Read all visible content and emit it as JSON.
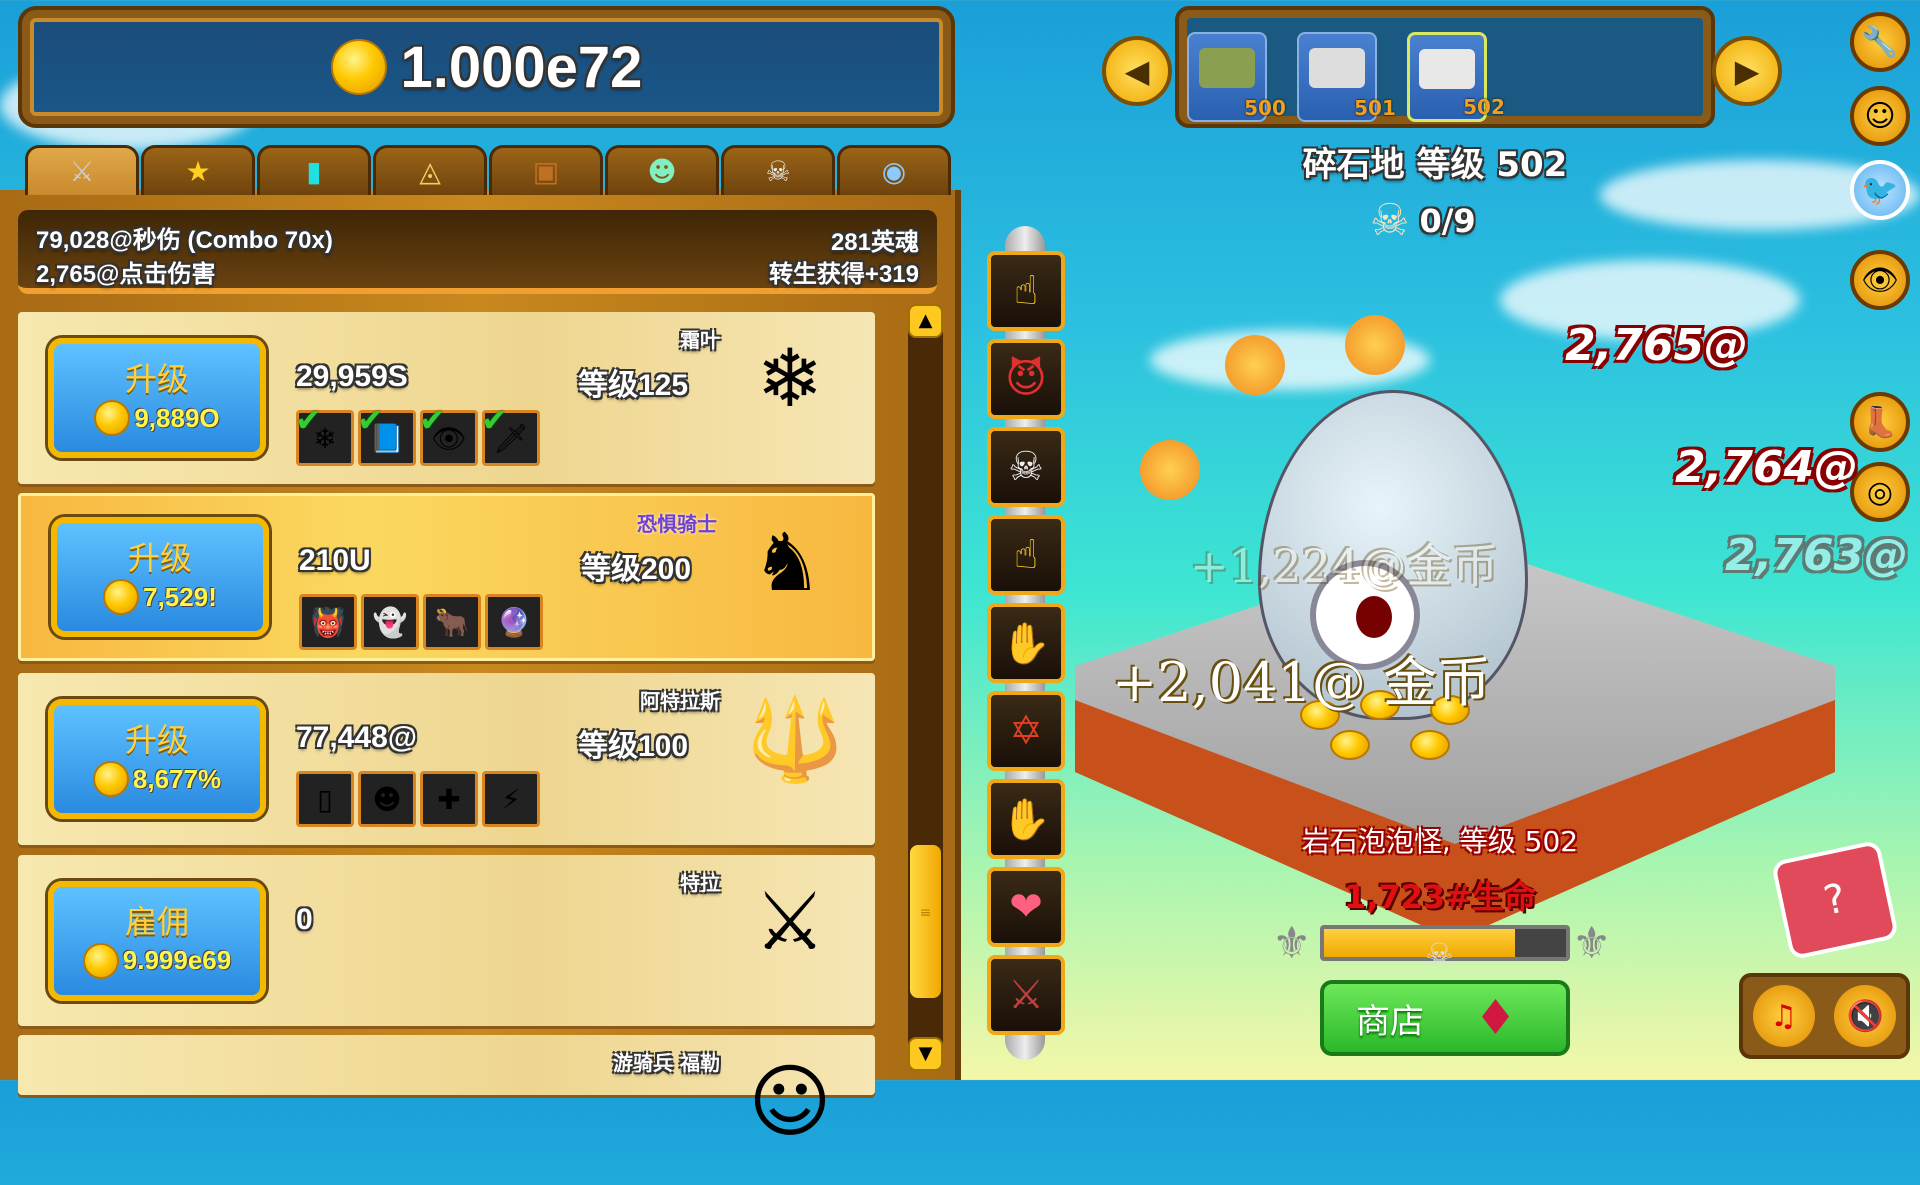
{
  "gold": {
    "value": "1.000e72",
    "icon": "gold-coin-icon"
  },
  "tabs": [
    {
      "name": "heroes",
      "icon": "crossed-swords-icon",
      "glyph": "⚔",
      "active": true
    },
    {
      "name": "achievements",
      "icon": "stars-icon",
      "glyph": "★"
    },
    {
      "name": "stats",
      "icon": "bar-chart-icon",
      "glyph": "▮"
    },
    {
      "name": "ancients",
      "icon": "pyramid-eye-icon",
      "glyph": "◬"
    },
    {
      "name": "relics",
      "icon": "chest-icon",
      "glyph": "▣"
    },
    {
      "name": "clans",
      "icon": "clan-people-icon",
      "glyph": "☻"
    },
    {
      "name": "mercenaries",
      "icon": "skull-icon",
      "glyph": "☠"
    },
    {
      "name": "transcendence",
      "icon": "orb-eye-icon",
      "glyph": "◉"
    }
  ],
  "stats": {
    "dps": "79,028@秒伤 (Combo 70x)",
    "click_damage": "2,765@点击伤害",
    "hero_souls": "281英魂",
    "ascend_gain": "转生获得+319"
  },
  "heroes": [
    {
      "name": "霜叶",
      "dps": "29,959S",
      "level": "等级125",
      "button": "升级",
      "cost": "9,889O",
      "highlighted": false,
      "avatar": "❄",
      "upgrades": [
        {
          "g": "❄",
          "bought": true
        },
        {
          "g": "📘",
          "bought": true
        },
        {
          "g": "👁",
          "bought": true
        },
        {
          "g": "🗡",
          "bought": true
        }
      ]
    },
    {
      "name": "恐惧骑士",
      "dps": "210U",
      "level": "等级200",
      "button": "升级",
      "cost": "7,529!",
      "highlighted": true,
      "avatar": "♞",
      "upgrades": [
        {
          "g": "👹",
          "bought": false
        },
        {
          "g": "👻",
          "bought": false
        },
        {
          "g": "🐂",
          "bought": false
        },
        {
          "g": "🔮",
          "bought": false
        }
      ]
    },
    {
      "name": "阿特拉斯",
      "dps": "77,448@",
      "level": "等级100",
      "button": "升级",
      "cost": "8,677%",
      "highlighted": false,
      "avatar": "🔱",
      "upgrades": [
        {
          "g": "▯",
          "bought": false
        },
        {
          "g": "☻",
          "bought": false
        },
        {
          "g": "✚",
          "bought": false
        },
        {
          "g": "⚡",
          "bought": false
        }
      ]
    },
    {
      "name": "特拉",
      "dps": "0",
      "level": "",
      "button": "雇佣",
      "cost": "9.999e69",
      "highlighted": false,
      "avatar": "⚔",
      "upgrades": []
    },
    {
      "name": "游骑兵 福勒",
      "dps": "",
      "level": "",
      "button": "",
      "cost": "",
      "highlighted": false,
      "avatar": "☺",
      "upgrades": []
    }
  ],
  "skills": [
    {
      "name": "clickstorm",
      "glyph": "☝"
    },
    {
      "name": "powersurge",
      "glyph": "😈"
    },
    {
      "name": "lucky-strikes",
      "glyph": "☠"
    },
    {
      "name": "metal-detector",
      "glyph": "☝"
    },
    {
      "name": "golden-clicks",
      "glyph": "✋"
    },
    {
      "name": "dark-ritual",
      "glyph": "✡"
    },
    {
      "name": "super-clicks",
      "glyph": "✋"
    },
    {
      "name": "energize",
      "glyph": "❤"
    },
    {
      "name": "reload",
      "glyph": "⚔"
    }
  ],
  "zones": [
    {
      "number": "500",
      "current": false
    },
    {
      "number": "501",
      "current": false
    },
    {
      "number": "502",
      "current": true
    }
  ],
  "zone_title": "碎石地 等级 502",
  "kills": "0/9",
  "floating": {
    "damage": [
      "2,765@",
      "2,764@",
      "2,763@"
    ],
    "gold_main": "+2,041@ 金币",
    "gold_faded": "+1,224@金币"
  },
  "monster": {
    "name": "岩石泡泡怪, 等级 502",
    "hp": "1,723#生命",
    "hp_fraction": 0.79
  },
  "shop": {
    "label": "商店"
  },
  "colors": {
    "accent": "#f5b800",
    "hp_fill": "#f0a800",
    "shop": "#2ab82a"
  }
}
